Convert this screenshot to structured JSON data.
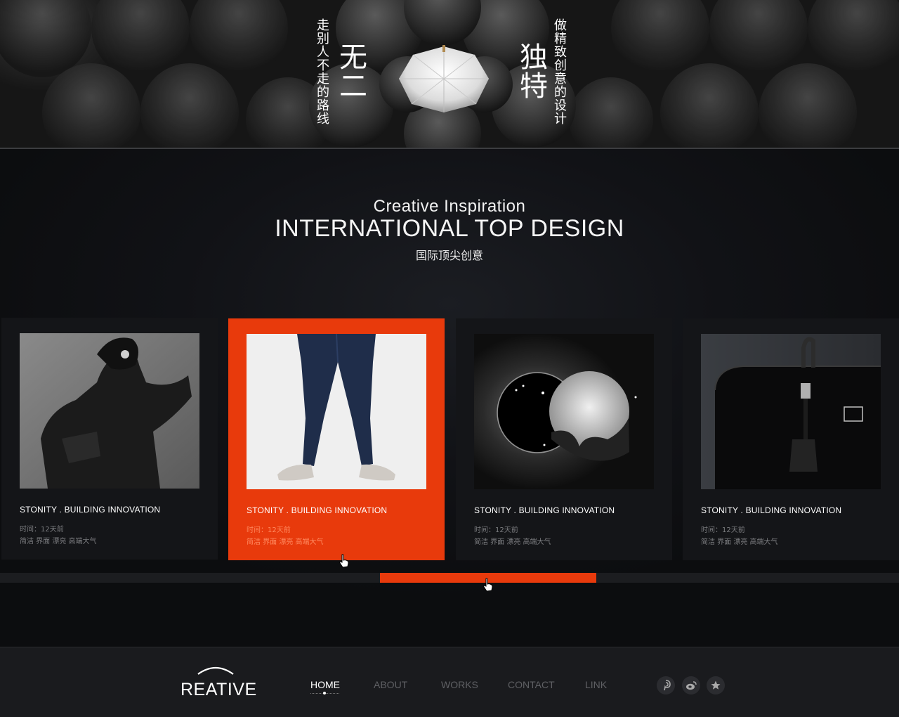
{
  "hero": {
    "left_small": "走别人不走的路线",
    "left_big": "无二",
    "right_big": "独特",
    "right_small": "做精致创意的设计"
  },
  "heading": {
    "sub": "Creative  Inspiration",
    "main": "INTERNATIONAL TOP DESIGN",
    "cn": "国际顶尖创意"
  },
  "cards": [
    {
      "title": "STONITY . BUILDING INNOVATION",
      "time": "时间：12天前",
      "tags": "简洁 界面 漂亮 高端大气",
      "image": "fashion-model-photo",
      "active": false
    },
    {
      "title": "STONITY . BUILDING INNOVATION",
      "time": "时间：12天前",
      "tags": "简洁 界面 漂亮 高端大气",
      "image": "jeans-legs-photo",
      "active": true
    },
    {
      "title": "STONITY . BUILDING INNOVATION",
      "time": "时间：12天前",
      "tags": "简洁 界面 漂亮 高端大气",
      "image": "eclipse-moon-artwork",
      "active": false
    },
    {
      "title": "STONITY . BUILDING INNOVATION",
      "time": "时间：12天前",
      "tags": "简洁 界面 漂亮 高端大气",
      "image": "black-handbag-photo",
      "active": false
    }
  ],
  "footer": {
    "logo": "REATIVE",
    "nav": [
      "HOME",
      "ABOUT",
      "WORKS",
      "CONTACT",
      "LINK"
    ],
    "active_nav": "HOME",
    "social_icons": [
      "pinterest-icon",
      "weibo-icon",
      "star-icon"
    ]
  },
  "colors": {
    "accent": "#e83a0c",
    "background": "#0d0e10",
    "card": "#141518"
  }
}
